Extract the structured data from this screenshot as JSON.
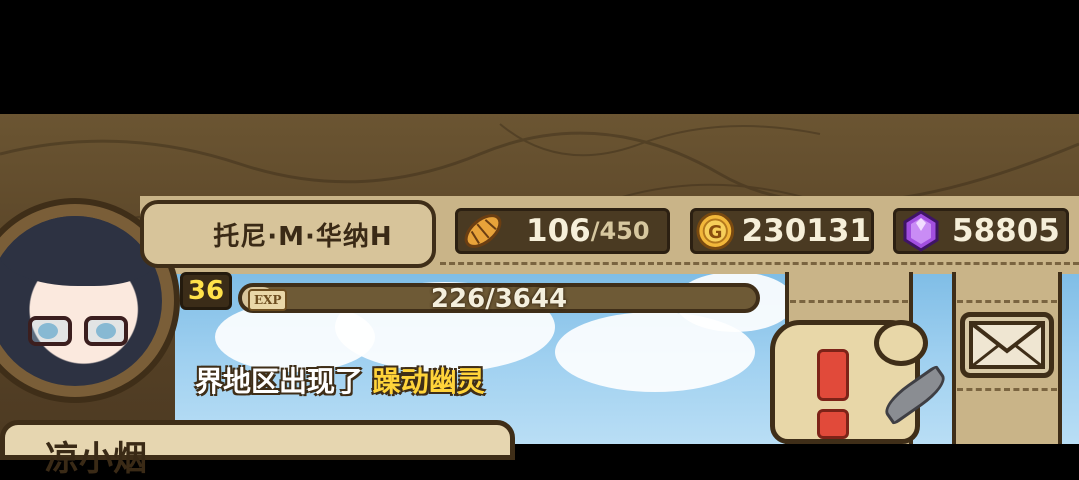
{
  "player": {
    "name": "托尼·M·华纳H",
    "level": "36"
  },
  "resources": {
    "stamina": {
      "current": "106",
      "max": "/450",
      "icon": "bread-icon"
    },
    "gold": {
      "value": "230131",
      "icon": "gold-coin-icon"
    },
    "gems": {
      "value": "58805",
      "icon": "purple-gem-icon"
    }
  },
  "exp": {
    "tag": "EXP",
    "text": "226/3644",
    "fraction": 0.062
  },
  "announcement": {
    "prefix": "界地区出现了",
    "highlight": "躁动幽灵"
  },
  "bottom_panel": {
    "title": "凉小烟"
  },
  "buttons": {
    "mail": {
      "icon": "envelope-icon"
    },
    "quest": {
      "icon": "quest-scroll-icon"
    }
  },
  "colors": {
    "level_text": "#ffe24a",
    "highlight_text": "#ffd43a",
    "frame_brown": "#3f2e18",
    "parchment": "#c9b488"
  }
}
